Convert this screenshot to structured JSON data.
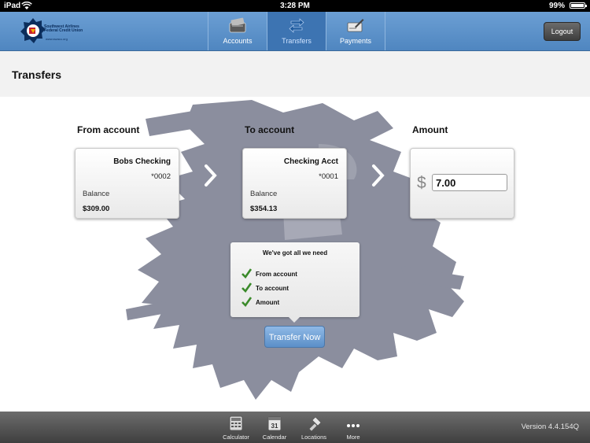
{
  "status_bar": {
    "carrier": "iPad",
    "time": "3:28 PM",
    "battery": "99%"
  },
  "header": {
    "logo_lines": [
      "Southwest Airlines",
      "Federal Credit Union"
    ],
    "logo_url": "www.swacu.org",
    "tabs": [
      {
        "label": "Accounts",
        "icon": "wallet-icon",
        "active": false
      },
      {
        "label": "Transfers",
        "icon": "transfer-arrows-icon",
        "active": true
      },
      {
        "label": "Payments",
        "icon": "check-pen-icon",
        "active": false
      }
    ],
    "logout_label": "Logout"
  },
  "page": {
    "title": "Transfers"
  },
  "transfer": {
    "from_label": "From account",
    "to_label": "To account",
    "amount_label": "Amount",
    "from_account": {
      "name": "Bobs Checking",
      "number": "*0002",
      "balance_label": "Balance",
      "balance": "$309.00"
    },
    "to_account": {
      "name": "Checking Acct",
      "number": "*0001",
      "balance_label": "Balance",
      "balance": "$354.13"
    },
    "currency_symbol": "$",
    "amount_value": "7.00",
    "checklist": {
      "heading": "We've got all we need",
      "items": [
        "From account",
        "To account",
        "Amount"
      ]
    },
    "submit_label": "Transfer Now"
  },
  "bottom_bar": {
    "items": [
      {
        "label": "Calculator",
        "icon": "calculator-icon"
      },
      {
        "label": "Calendar",
        "icon": "calendar-icon",
        "day": "31"
      },
      {
        "label": "Locations",
        "icon": "locations-icon"
      },
      {
        "label": "More",
        "icon": "more-dots-icon"
      }
    ],
    "version": "Version 4.4.154Q"
  },
  "colors": {
    "header_blue": "#5b8fc8",
    "active_tab": "#3d74b2",
    "backdrop_gray": "#8b8e9e",
    "check_green": "#3a8a2a"
  }
}
